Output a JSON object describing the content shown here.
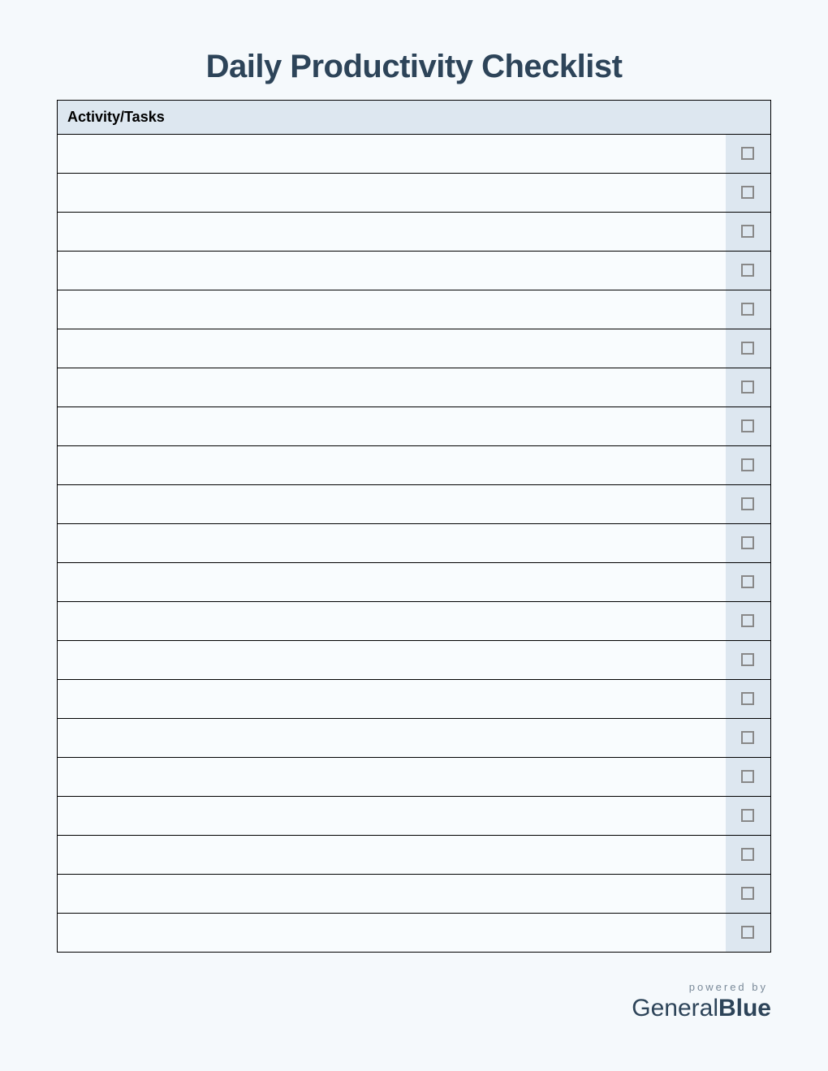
{
  "title": "Daily Productivity Checklist",
  "table": {
    "header": "Activity/Tasks",
    "rows": [
      {
        "task": "",
        "checked": false
      },
      {
        "task": "",
        "checked": false
      },
      {
        "task": "",
        "checked": false
      },
      {
        "task": "",
        "checked": false
      },
      {
        "task": "",
        "checked": false
      },
      {
        "task": "",
        "checked": false
      },
      {
        "task": "",
        "checked": false
      },
      {
        "task": "",
        "checked": false
      },
      {
        "task": "",
        "checked": false
      },
      {
        "task": "",
        "checked": false
      },
      {
        "task": "",
        "checked": false
      },
      {
        "task": "",
        "checked": false
      },
      {
        "task": "",
        "checked": false
      },
      {
        "task": "",
        "checked": false
      },
      {
        "task": "",
        "checked": false
      },
      {
        "task": "",
        "checked": false
      },
      {
        "task": "",
        "checked": false
      },
      {
        "task": "",
        "checked": false
      },
      {
        "task": "",
        "checked": false
      },
      {
        "task": "",
        "checked": false
      },
      {
        "task": "",
        "checked": false
      }
    ]
  },
  "footer": {
    "powered_by": "powered by",
    "brand_light": "General",
    "brand_bold": "Blue"
  },
  "colors": {
    "title": "#2d4459",
    "header_bg": "#dde7f0",
    "page_bg": "#f5f9fc"
  }
}
